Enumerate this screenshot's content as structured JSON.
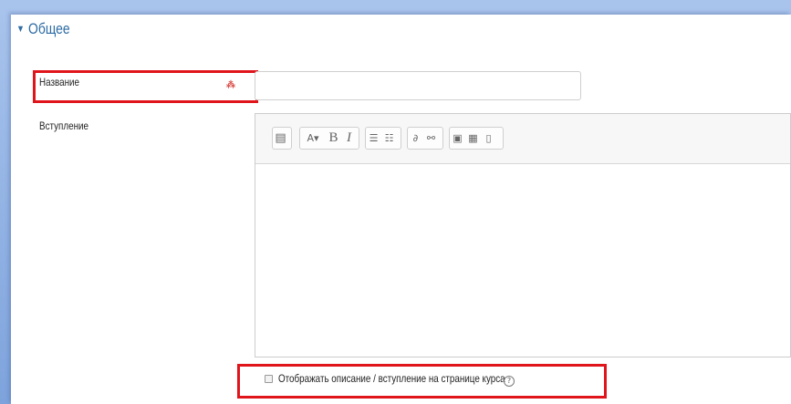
{
  "section": {
    "title": "Общее",
    "toggle_icon": "caret-down-icon"
  },
  "fields": {
    "name": {
      "label": "Название",
      "value": "",
      "required_icon": "required-icon"
    },
    "intro": {
      "label": "Вступление"
    }
  },
  "editor": {
    "toolbar": [
      {
        "name": "toolbar-toggle-icon",
        "glyph": "▤"
      },
      {
        "name": "font-color-icon",
        "glyph": "A▾"
      },
      {
        "name": "bold-icon",
        "glyph": "B"
      },
      {
        "name": "italic-icon",
        "glyph": "I"
      },
      {
        "name": "bullet-list-icon",
        "glyph": "☰"
      },
      {
        "name": "numbered-list-icon",
        "glyph": "☷"
      },
      {
        "name": "link-icon",
        "glyph": "🔗"
      },
      {
        "name": "unlink-icon",
        "glyph": "⛓"
      },
      {
        "name": "image-icon",
        "glyph": "▣"
      },
      {
        "name": "media-icon",
        "glyph": "▦"
      },
      {
        "name": "manage-files-icon",
        "glyph": "▯"
      }
    ]
  },
  "display_option": {
    "label": "Отображать описание / вступление на странице курса",
    "checked": false,
    "help_icon": "help-icon"
  },
  "colors": {
    "highlight": "#e0151b",
    "section_title": "#2e6ca4",
    "required": "#d9534f"
  }
}
